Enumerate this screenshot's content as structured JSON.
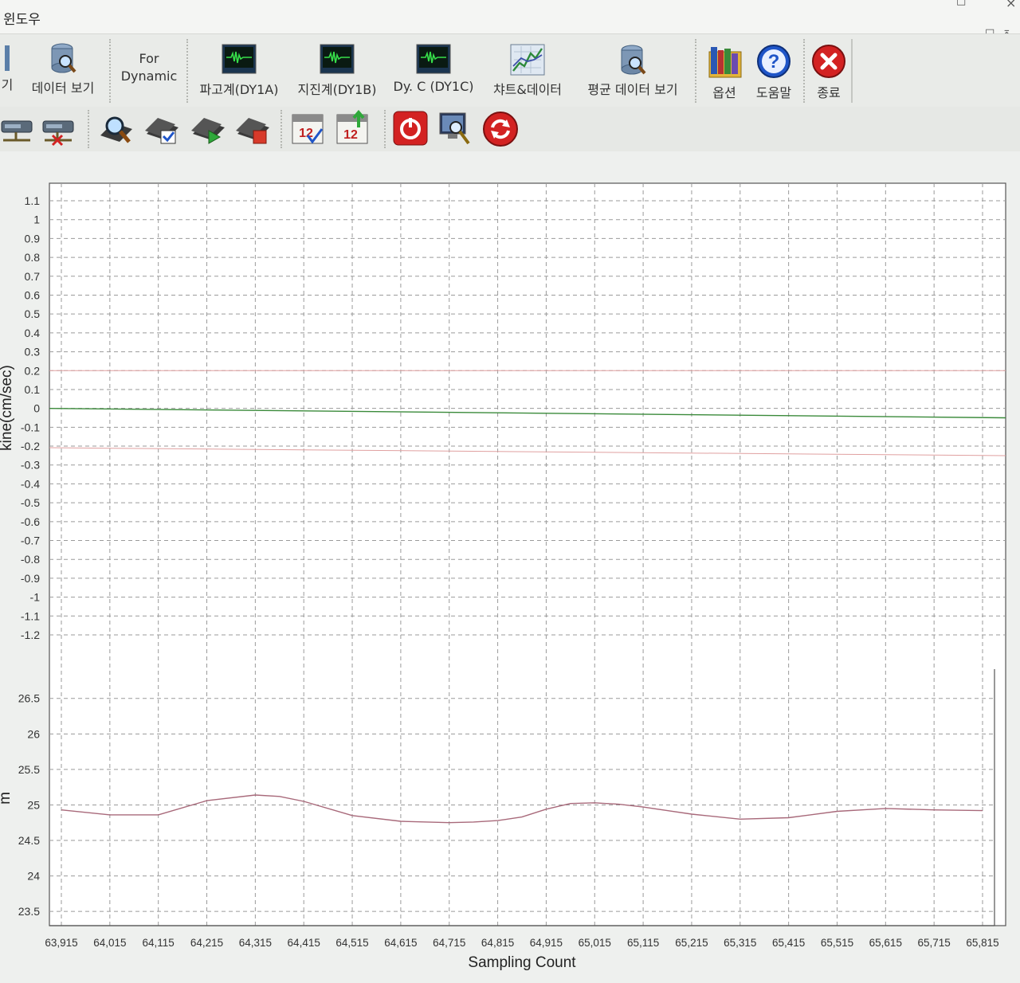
{
  "menu": {
    "window_label": "윈도우"
  },
  "toolbar": {
    "cut_label": "기",
    "data_view_label": "데이터 보기",
    "for_dynamic_line1": "For",
    "for_dynamic_line2": "Dynamic",
    "dy1a_label": "파고계(DY1A)",
    "dy1b_label": "지진계(DY1B)",
    "dy1c_label": "Dy. C (DY1C)",
    "chart_data_label": "챠트&데이터",
    "avg_data_label": "평균 데이터 보기",
    "options_label": "옵션",
    "help_label": "도움말",
    "exit_label": "종료"
  },
  "icons": {
    "data_view": "database-search-icon",
    "dy1a": "waveform-monitor-icon",
    "dy1b": "waveform-monitor-icon",
    "dy1c": "waveform-monitor-icon",
    "chart_data": "line-chart-icon",
    "avg_data": "database-search-icon",
    "options": "folder-books-icon",
    "help": "question-icon",
    "exit": "close-icon"
  },
  "colors": {
    "accent_exit": "#d32222",
    "accent_help": "#1f55c8",
    "waveform_green": "#37e04a",
    "upper_line": "#3a8a3a",
    "lower_line": "#a8697a"
  },
  "chart_data": [
    {
      "type": "line",
      "ylabel": "kine(cm/sec)",
      "ylim": [
        -1.2,
        1.1
      ],
      "yticks": [
        "1.1",
        "1",
        "0.9",
        "0.8",
        "0.7",
        "0.6",
        "0.5",
        "0.4",
        "0.3",
        "0.2",
        "0.1",
        "0",
        "-0.1",
        "-0.2",
        "-0.3",
        "-0.4",
        "-0.5",
        "-0.6",
        "-0.7",
        "-0.8",
        "-0.9",
        "-1",
        "-1.1",
        "-1.2"
      ],
      "grid": true,
      "series": [
        {
          "values_x": [
            63915,
            65815
          ],
          "values_y": [
            0.0,
            -0.05
          ]
        }
      ]
    },
    {
      "type": "line",
      "ylabel": "m",
      "ylim": [
        23.3,
        26.8
      ],
      "yticks": [
        "26.5",
        "26",
        "25.5",
        "25",
        "24.5",
        "24",
        "23.5"
      ],
      "xlabel": "Sampling Count",
      "xticks": [
        "63,915",
        "64,015",
        "64,115",
        "64,215",
        "64,315",
        "64,415",
        "64,515",
        "64,615",
        "64,715",
        "64,815",
        "64,915",
        "65,015",
        "65,115",
        "65,215",
        "65,315",
        "65,415",
        "65,515",
        "65,615",
        "65,715",
        "65,815"
      ],
      "grid": true,
      "series": [
        {
          "x": [
            63915,
            64015,
            64115,
            64215,
            64315,
            64365,
            64415,
            64515,
            64615,
            64715,
            64765,
            64815,
            64865,
            64915,
            64965,
            65015,
            65065,
            65115,
            65165,
            65215,
            65315,
            65415,
            65515,
            65615,
            65715,
            65815
          ],
          "y": [
            24.93,
            24.86,
            24.86,
            25.06,
            25.14,
            25.12,
            25.05,
            24.85,
            24.77,
            24.75,
            24.76,
            24.78,
            24.83,
            24.94,
            25.02,
            25.03,
            25.01,
            24.97,
            24.92,
            24.87,
            24.8,
            24.82,
            24.91,
            24.95,
            24.93,
            24.92
          ]
        }
      ]
    }
  ]
}
